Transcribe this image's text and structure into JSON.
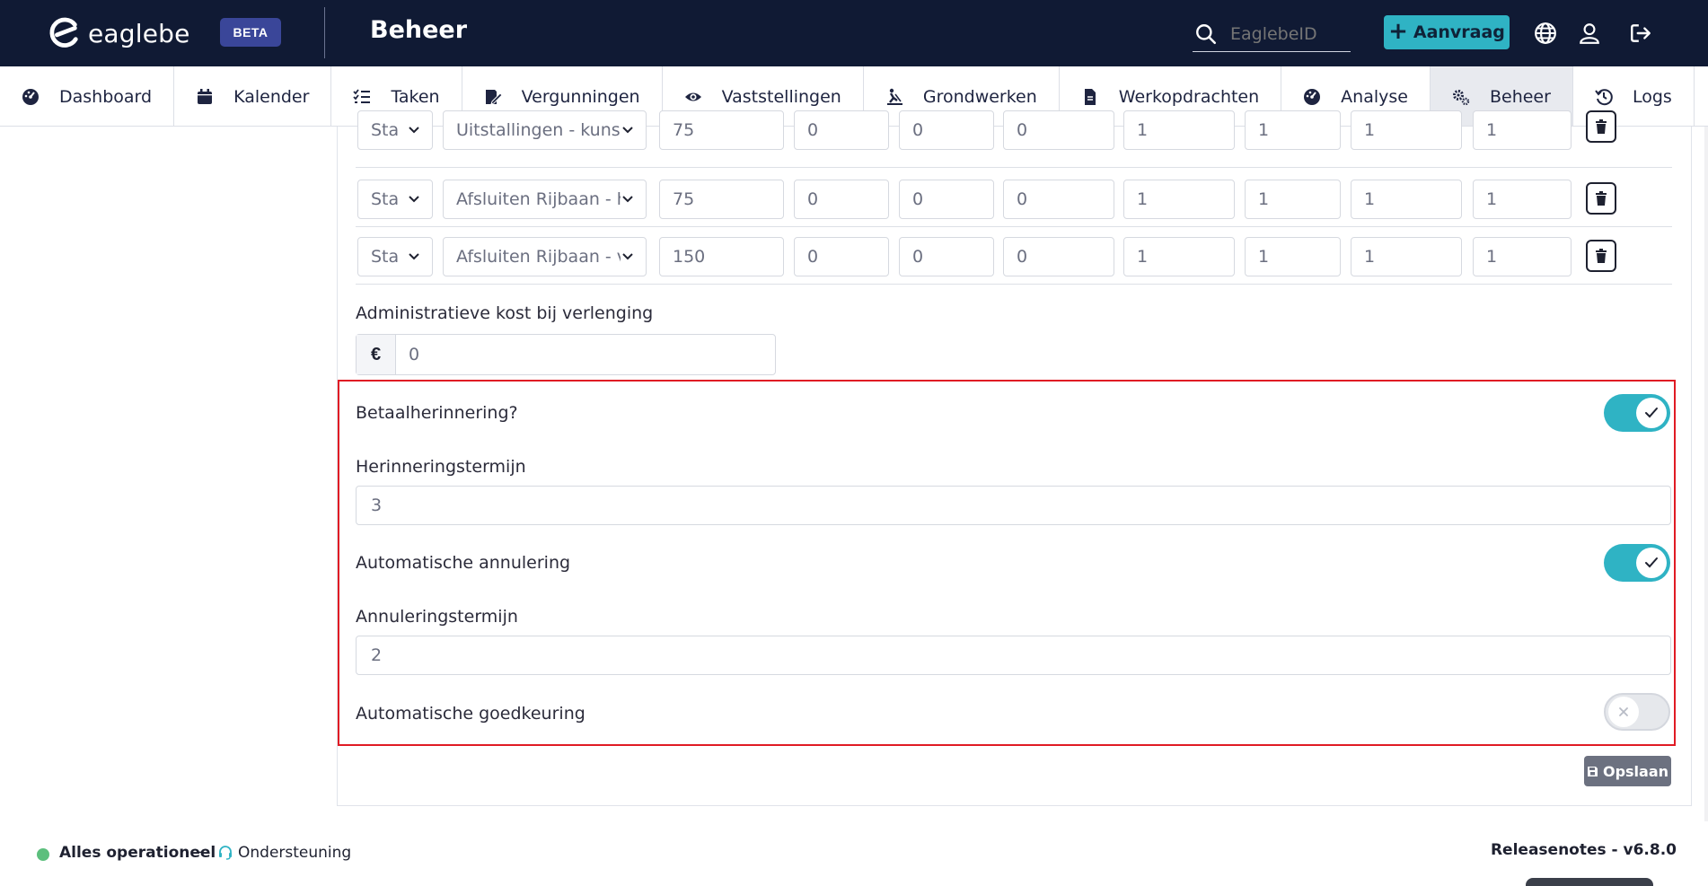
{
  "app": {
    "logo_text": "eaglebe",
    "beta_label": "BETA",
    "section_title": "Beheer"
  },
  "topbar": {
    "search_placeholder": "EaglebeID",
    "aanvraag_label": "Aanvraag"
  },
  "nav": {
    "items": [
      {
        "label": "Dashboard",
        "icon": "dashboard-gauge-icon"
      },
      {
        "label": "Kalender",
        "icon": "calendar-icon"
      },
      {
        "label": "Taken",
        "icon": "tasks-list-icon"
      },
      {
        "label": "Vergunningen",
        "icon": "permit-edit-icon"
      },
      {
        "label": "Vaststellingen",
        "icon": "eye-icon"
      },
      {
        "label": "Grondwerken",
        "icon": "digging-icon"
      },
      {
        "label": "Werkopdrachten",
        "icon": "document-icon"
      },
      {
        "label": "Analyse",
        "icon": "analytics-gauge-icon"
      },
      {
        "label": "Beheer",
        "icon": "gears-icon",
        "active": true
      },
      {
        "label": "Logs",
        "icon": "history-icon"
      }
    ]
  },
  "table": {
    "rows": [
      {
        "type": "Sta",
        "name": "Uitstallingen - kunst",
        "price": "75",
        "v1": "0",
        "v2": "0",
        "v3": "0",
        "v4": "1",
        "v5": "1",
        "v6": "1",
        "v7": "1"
      },
      {
        "type": "Sta",
        "name": "Afsluiten Rijbaan - h",
        "price": "75",
        "v1": "0",
        "v2": "0",
        "v3": "0",
        "v4": "1",
        "v5": "1",
        "v6": "1",
        "v7": "1"
      },
      {
        "type": "Sta",
        "name": "Afsluiten Rijbaan - v",
        "price": "150",
        "v1": "0",
        "v2": "0",
        "v3": "0",
        "v4": "1",
        "v5": "1",
        "v6": "1",
        "v7": "1"
      }
    ]
  },
  "form": {
    "admin_cost_label": "Administratieve kost bij verlenging",
    "currency_symbol": "€",
    "admin_cost_value": "0",
    "payment_reminder_label": "Betaalherinnering?",
    "payment_reminder_on": true,
    "reminder_term_label": "Herinneringstermijn",
    "reminder_term_value": "3",
    "auto_cancel_label": "Automatische annulering",
    "auto_cancel_on": true,
    "cancel_term_label": "Annuleringstermijn",
    "cancel_term_value": "2",
    "auto_approve_label": "Automatische goedkeuring",
    "auto_approve_on": false,
    "save_label": "Opslaan"
  },
  "footer": {
    "status_text": "Alles operationeel",
    "separator": "-",
    "support_label": "Ondersteuning",
    "release_text": "Releasenotes - v6.8.0"
  },
  "colors": {
    "topbar_bg": "#101a34",
    "accent": "#2fb3c4",
    "beta_bg": "#3a4699",
    "highlight_border": "#e01b24",
    "status_ok": "#5cbf7d"
  }
}
